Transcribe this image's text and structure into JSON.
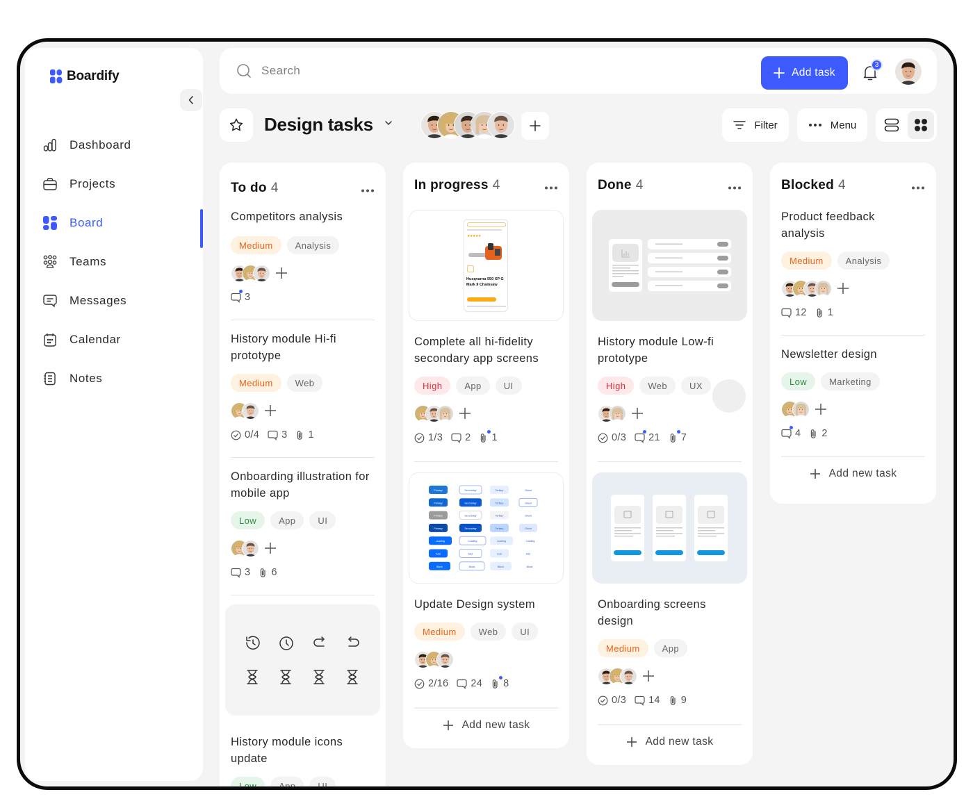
{
  "app": {
    "name": "Boardify",
    "brand_color": "#3d5afe"
  },
  "sidebar": {
    "collapse_label": "Collapse sidebar",
    "items": [
      {
        "label": "Dashboard",
        "icon": "bar-chart-icon",
        "active": false
      },
      {
        "label": "Projects",
        "icon": "briefcase-icon",
        "active": false
      },
      {
        "label": "Board",
        "icon": "board-grid-icon",
        "active": true
      },
      {
        "label": "Teams",
        "icon": "team-icon",
        "active": false
      },
      {
        "label": "Messages",
        "icon": "message-icon",
        "active": false
      },
      {
        "label": "Calendar",
        "icon": "calendar-icon",
        "active": false
      },
      {
        "label": "Notes",
        "icon": "notes-icon",
        "active": false
      }
    ]
  },
  "topbar": {
    "search_placeholder": "Search",
    "add_task_label": "Add task",
    "notification_count": "3"
  },
  "board": {
    "title": "Design tasks",
    "member_count": 5,
    "filter_label": "Filter",
    "menu_label": "Menu",
    "view_mode": "grid"
  },
  "columns": [
    {
      "title": "To do",
      "count": "4",
      "cards": [
        {
          "title": "Competitors analysis",
          "tags": [
            {
              "label": "Medium",
              "type": "medium"
            },
            {
              "label": "Analysis",
              "type": "plain"
            }
          ],
          "assignees": 3,
          "add_assignee": true,
          "meta": {
            "comments": "3",
            "comments_dot": true
          }
        },
        {
          "title": "History module Hi-fi prototype",
          "tags": [
            {
              "label": "Medium",
              "type": "medium"
            },
            {
              "label": "Web",
              "type": "plain"
            }
          ],
          "assignees": 2,
          "add_assignee": true,
          "meta": {
            "checklist": "0/4",
            "comments": "3",
            "attachments": "1"
          }
        },
        {
          "title": "Onboarding illustration for mobile app",
          "tags": [
            {
              "label": "Low",
              "type": "low"
            },
            {
              "label": "App",
              "type": "plain"
            },
            {
              "label": "UI",
              "type": "plain"
            }
          ],
          "assignees": 2,
          "add_assignee": true,
          "meta": {
            "comments": "3",
            "attachments": "6"
          }
        },
        {
          "title": "History module icons update",
          "thumb": "history-icons",
          "tags": [
            {
              "label": "Low",
              "type": "low"
            },
            {
              "label": "App",
              "type": "plain"
            },
            {
              "label": "UI",
              "type": "plain"
            }
          ]
        }
      ]
    },
    {
      "title": "In progress",
      "count": "4",
      "cards": [
        {
          "title": "Complete all hi-fidelity secondary app screens",
          "thumb": "product-screen",
          "thumb_text": {
            "product": "Husqvarna 550 XP G Mark II Chainsaw",
            "cta": "Add to basket",
            "ratings": "17 ratings"
          },
          "tags": [
            {
              "label": "High",
              "type": "high"
            },
            {
              "label": "App",
              "type": "plain"
            },
            {
              "label": "UI",
              "type": "plain"
            }
          ],
          "assignees": 3,
          "add_assignee": true,
          "meta": {
            "checklist": "1/3",
            "comments": "2",
            "attachments": "1",
            "attachments_dot": true
          }
        },
        {
          "title": "Update Design system",
          "thumb": "design-system",
          "thumb_text": {
            "labels": [
              "Primary",
              "Secondary",
              "Tertiary",
              "Ghost",
              "Loading",
              "Add",
              "Block"
            ]
          },
          "tags": [
            {
              "label": "Medium",
              "type": "medium"
            },
            {
              "label": "Web",
              "type": "plain"
            },
            {
              "label": "UI",
              "type": "plain"
            }
          ],
          "assignees": 3,
          "add_assignee": false,
          "meta": {
            "checklist": "2/16",
            "comments": "24",
            "attachments": "8",
            "attachments_dot": true
          }
        }
      ],
      "add_new_label": "Add new task"
    },
    {
      "title": "Done",
      "count": "4",
      "cards": [
        {
          "title": "History module Low-fi prototype",
          "thumb": "lowfi",
          "tags": [
            {
              "label": "High",
              "type": "high"
            },
            {
              "label": "Web",
              "type": "plain"
            },
            {
              "label": "UX",
              "type": "plain"
            }
          ],
          "assignees": 2,
          "add_assignee": true,
          "meta": {
            "checklist": "0/3",
            "comments": "21",
            "comments_dot": true,
            "attachments": "7",
            "attachments_dot": true
          }
        },
        {
          "title": "Onboarding screens design",
          "thumb": "onboarding",
          "tags": [
            {
              "label": "Medium",
              "type": "medium"
            },
            {
              "label": "App",
              "type": "plain"
            }
          ],
          "assignees": 3,
          "add_assignee": true,
          "meta": {
            "checklist": "0/3",
            "comments": "14",
            "attachments": "9"
          }
        }
      ],
      "add_new_label": "Add new task"
    },
    {
      "title": "Blocked",
      "count": "4",
      "cards": [
        {
          "title": "Product feedback analysis",
          "tags": [
            {
              "label": "Medium",
              "type": "medium"
            },
            {
              "label": "Analysis",
              "type": "plain"
            }
          ],
          "assignees": 4,
          "add_assignee": true,
          "meta": {
            "comments": "12",
            "attachments": "1"
          }
        },
        {
          "title": "Newsletter design",
          "tags": [
            {
              "label": "Low",
              "type": "low"
            },
            {
              "label": "Marketing",
              "type": "plain"
            }
          ],
          "assignees": 2,
          "add_assignee": true,
          "meta": {
            "comments": "4",
            "comments_dot": true,
            "attachments": "2"
          }
        }
      ],
      "add_new_label": "Add new task"
    }
  ]
}
